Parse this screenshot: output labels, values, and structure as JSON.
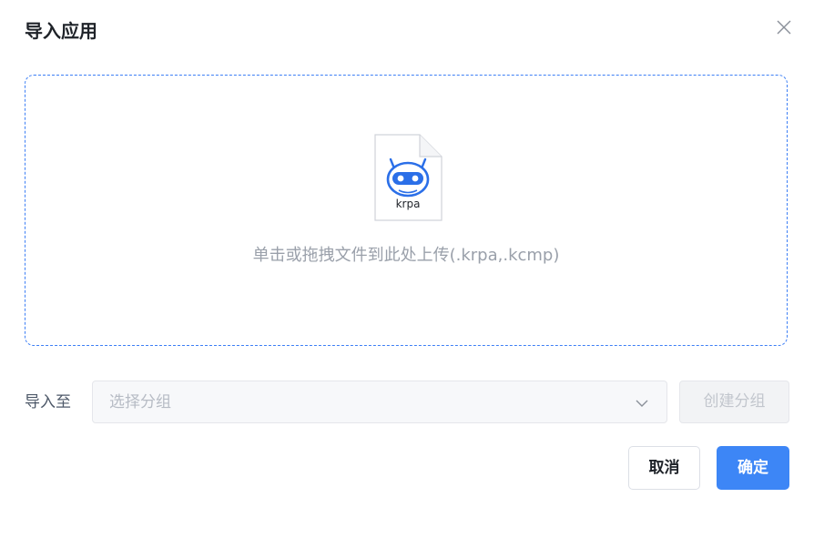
{
  "dialog": {
    "title": "导入应用",
    "close_icon": "close-icon"
  },
  "upload": {
    "file_icon": "krpa-file-icon",
    "file_extension": "krpa",
    "hint": "单击或拖拽文件到此处上传(.krpa,.kcmp)",
    "border_color": "#3d7ff5"
  },
  "import_to": {
    "label": "导入至",
    "select_placeholder": "选择分组",
    "chevron_icon": "chevron-down-icon",
    "create_group_label": "创建分组"
  },
  "footer": {
    "cancel_label": "取消",
    "ok_label": "确定",
    "accent_color": "#3d86f6"
  }
}
